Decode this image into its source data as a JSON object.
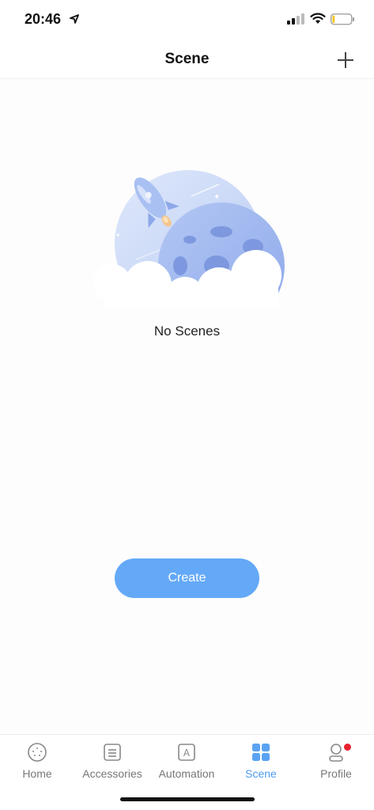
{
  "status_bar": {
    "time": "20:46"
  },
  "nav": {
    "title": "Scene",
    "add_icon": "plus-icon"
  },
  "empty_state": {
    "illustration": "rocket-moon-illustration",
    "message": "No Scenes"
  },
  "create_button": {
    "label": "Create"
  },
  "tabs": [
    {
      "label": "Home",
      "icon": "home-icon",
      "active": false
    },
    {
      "label": "Accessories",
      "icon": "accessories-icon",
      "active": false
    },
    {
      "label": "Automation",
      "icon": "automation-icon",
      "active": false
    },
    {
      "label": "Scene",
      "icon": "scene-grid-icon",
      "active": true
    },
    {
      "label": "Profile",
      "icon": "profile-icon",
      "active": false,
      "badge": true
    }
  ],
  "colors": {
    "accent": "#64a9f7",
    "active_tab": "#4a9bf0",
    "badge": "#e8202e",
    "battery_level": "#f5c400"
  },
  "battery": {
    "level_fraction": 0.12
  }
}
